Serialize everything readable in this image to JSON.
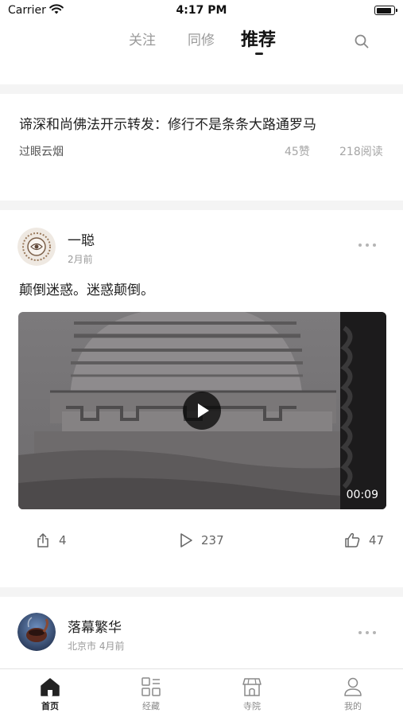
{
  "status_bar": {
    "carrier": "Carrier",
    "time": "4:17 PM"
  },
  "top_nav": {
    "tabs": [
      {
        "label": "关注",
        "active": false
      },
      {
        "label": "同修",
        "active": false
      },
      {
        "label": "推荐",
        "active": true
      }
    ],
    "search_icon": "search-icon"
  },
  "article": {
    "title": "谛深和尚佛法开示转发：修行不是条条大路通罗马",
    "author": "过眼云烟",
    "likes": "45赞",
    "reads": "218阅读"
  },
  "posts": [
    {
      "author": "一聪",
      "time": "2月前",
      "text": "颠倒迷惑。迷惑颠倒。",
      "video_duration": "00:09",
      "shares": "4",
      "plays": "237",
      "likes": "47"
    },
    {
      "author": "落幕繁华",
      "location_time": "北京市 4月前"
    }
  ],
  "bottom_nav": [
    {
      "label": "首页",
      "icon": "home-icon",
      "active": true
    },
    {
      "label": "经藏",
      "icon": "sutra-grid-icon",
      "active": false
    },
    {
      "label": "寺院",
      "icon": "temple-icon",
      "active": false
    },
    {
      "label": "我的",
      "icon": "profile-icon",
      "active": false
    }
  ],
  "colors": {
    "text_primary": "#222222",
    "text_secondary": "#9a9a9a",
    "separator": "#f4f4f4"
  }
}
